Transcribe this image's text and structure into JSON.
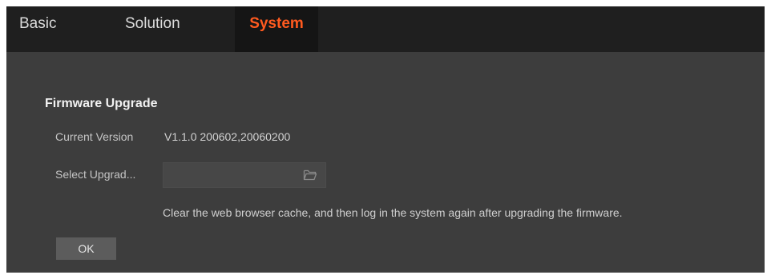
{
  "tabs": [
    {
      "label": "Basic"
    },
    {
      "label": "Solution"
    },
    {
      "label": "System",
      "active": true
    }
  ],
  "firmware": {
    "title": "Firmware Upgrade",
    "current_version_label": "Current Version",
    "current_version_value": "V1.1.0 200602,20060200",
    "select_upgrade_label": "Select Upgrad...",
    "file_value": "",
    "hint": "Clear the web browser cache, and then log in the system again after upgrading the firmware.",
    "ok_label": "OK"
  },
  "colors": {
    "active_tab": "#ff5a1f",
    "background": "#3d3d3d",
    "tabbar": "#1f1f1f"
  },
  "icons": {
    "browse": "folder-icon"
  }
}
